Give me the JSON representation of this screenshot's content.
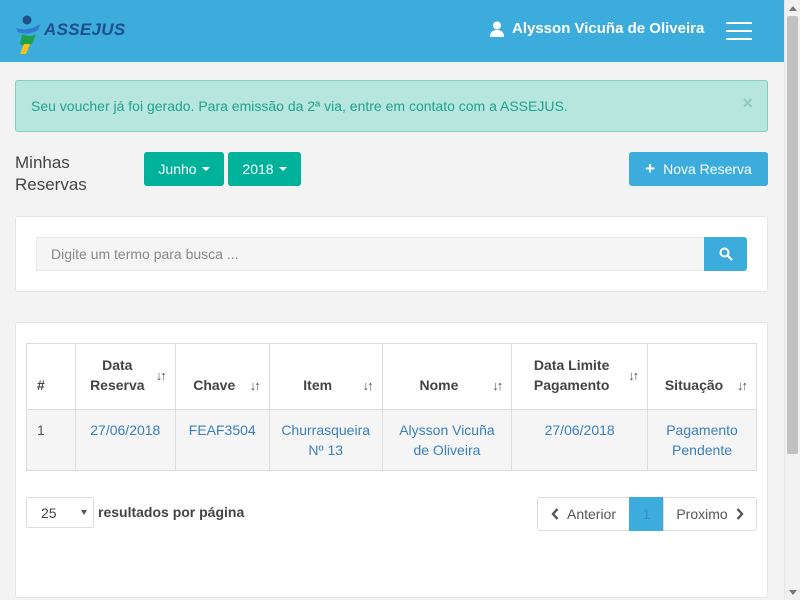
{
  "header": {
    "logo_text": "ASSEJUS",
    "user_name": "Alysson Vicuña de Oliveira",
    "icons": {
      "user": "user-icon",
      "menu": "hamburger-menu-icon"
    },
    "background_color": "#3cacdc"
  },
  "alert": {
    "message": "Seu voucher já foi gerado. Para emissão da 2ª via, entre em contato com a ASSEJUS.",
    "close_label": "×",
    "background_color": "#b7e6de"
  },
  "page": {
    "title_line1": "Minhas",
    "title_line2": "Reservas",
    "month_filter": "Junho",
    "year_filter": "2018",
    "new_button": "Nova Reserva",
    "accent_green": "#00b29a",
    "accent_blue": "#3cacdc"
  },
  "search": {
    "placeholder": "Digite um termo para busca ...",
    "icon": "search-icon"
  },
  "table": {
    "columns": [
      {
        "line1": "#",
        "line2": ""
      },
      {
        "line1": "Data",
        "line2": "Reserva"
      },
      {
        "line1": "Chave",
        "line2": ""
      },
      {
        "line1": "Item",
        "line2": ""
      },
      {
        "line1": "Nome",
        "line2": ""
      },
      {
        "line1": "Data Limite",
        "line2": "Pagamento"
      },
      {
        "line1": "Situação",
        "line2": ""
      }
    ],
    "sort_icon": "↓↑",
    "rows": [
      {
        "num": "1",
        "data_reserva": "27/06/2018",
        "chave": "FEAF3504",
        "item_line1": "Churrasqueira",
        "item_line2": "Nº 13",
        "nome_line1": "Alysson Vicuña",
        "nome_line2": "de Oliveira",
        "data_limite": "27/06/2018",
        "situacao_line1": "Pagamento",
        "situacao_line2": "Pendente"
      }
    ]
  },
  "footer": {
    "page_size": "25",
    "per_page_label": "resultados por página",
    "prev_label": "Anterior",
    "current_page": "1",
    "next_label": "Proximo"
  }
}
